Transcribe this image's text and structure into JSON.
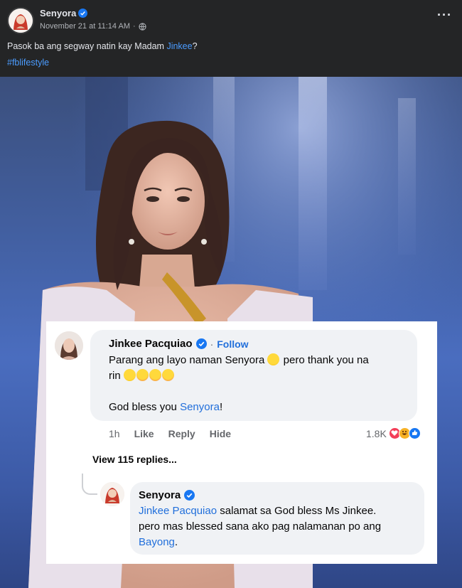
{
  "post": {
    "author": "Senyora",
    "timestamp": "November 21 at 11:14 AM",
    "separator": "·",
    "more_label": "···",
    "caption_prefix": "Pasok ba ang segway natin kay Madam ",
    "caption_mention": "Jinkee",
    "caption_suffix": "?",
    "hashtag": "#fblifestyle"
  },
  "comment": {
    "author": "Jinkee Pacquiao",
    "separator": "·",
    "follow_label": "Follow",
    "line1_prefix": "Parang ang layo naman Senyora ",
    "line1_suffix": " pero thank you na",
    "line2": "rin ",
    "line3_prefix": "God bless you ",
    "line3_mention": "Senyora",
    "line3_suffix": "!",
    "time": "1h",
    "like_label": "Like",
    "reply_label": "Reply",
    "hide_label": "Hide",
    "reaction_count": "1.8K"
  },
  "view_replies_label": "View 115 replies...",
  "reply": {
    "author": "Senyora",
    "mention": "Jinkee Pacquiao",
    "line1_suffix": " salamat sa God bless Ms Jinkee.",
    "line2": "pero mas blessed sana ako pag nalamanan po ang",
    "line3_mention": "Bayong",
    "line3_suffix": "."
  },
  "colors": {
    "link": "#216fdb",
    "dark_link": "#4b9cff",
    "verified": "#1877f2",
    "love": "#f33e58",
    "haha": "#f7b125",
    "like": "#1877f2"
  },
  "icons": [
    "verified-icon",
    "globe-icon",
    "more-icon",
    "heart-react-icon",
    "haha-react-icon",
    "like-react-icon"
  ]
}
